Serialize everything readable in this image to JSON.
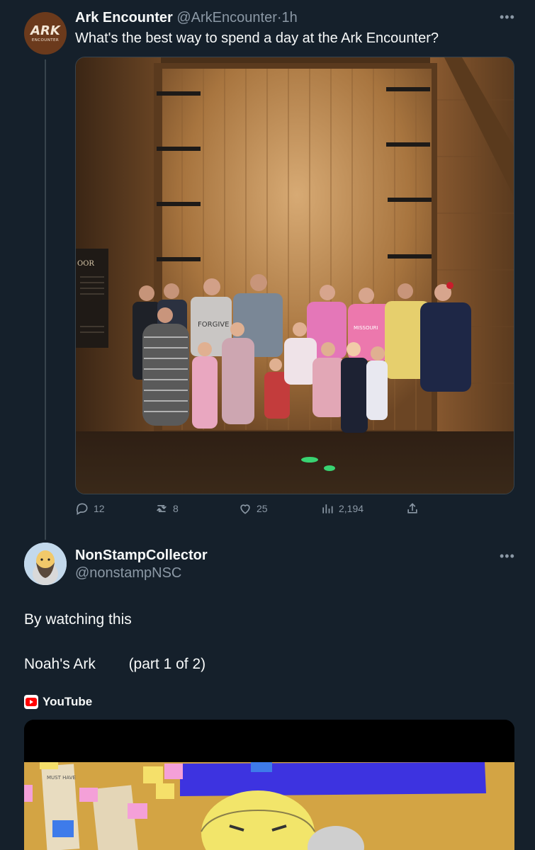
{
  "tweet1": {
    "avatar_logo": "ARK",
    "avatar_logo_sub": "ENCOUNTER",
    "name": "Ark Encounter",
    "handle": "@ArkEncounter",
    "separator": "·",
    "time": "1h",
    "text": "What's the best way to spend a day at the Ark Encounter?",
    "photo_sign_text": "OOR",
    "shirt_text_1": "FORGIVE",
    "shirt_text_2": "MISSOURI",
    "actions": {
      "replies": "12",
      "retweets": "8",
      "likes": "25",
      "views": "2,194"
    }
  },
  "tweet2": {
    "name": "NonStampCollector",
    "handle": "@nonstampNSC",
    "text_line1": "By watching this",
    "text_line2": "Noah's Ark        (part 1 of 2)",
    "source_label": "YouTube",
    "video_note_text": "MUST HAVE"
  },
  "colors": {
    "background": "#15202b",
    "primary_text": "#f7f9f9",
    "secondary_text": "#8b98a5",
    "divider": "#38444d",
    "youtube_red": "#ff0000"
  }
}
